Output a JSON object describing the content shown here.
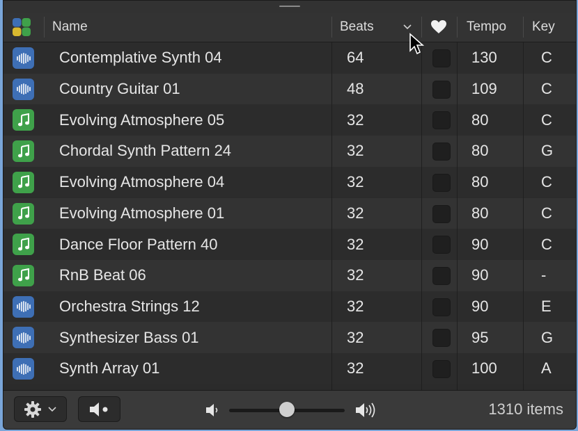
{
  "header": {
    "name": "Name",
    "beats": "Beats",
    "tempo": "Tempo",
    "key": "Key",
    "sort_icon": "chevron-down-icon",
    "favorite_icon": "heart-icon",
    "category_icon": "four-color-grid-icon"
  },
  "rows": [
    {
      "type": "audio",
      "name": "Contemplative Synth 04",
      "beats": "64",
      "tempo": "130",
      "key": "C"
    },
    {
      "type": "audio",
      "name": "Country Guitar 01",
      "beats": "48",
      "tempo": "109",
      "key": "C"
    },
    {
      "type": "midi",
      "name": "Evolving Atmosphere 05",
      "beats": "32",
      "tempo": "80",
      "key": "C"
    },
    {
      "type": "midi",
      "name": "Chordal Synth Pattern 24",
      "beats": "32",
      "tempo": "80",
      "key": "G"
    },
    {
      "type": "midi",
      "name": "Evolving Atmosphere 04",
      "beats": "32",
      "tempo": "80",
      "key": "C"
    },
    {
      "type": "midi",
      "name": "Evolving Atmosphere 01",
      "beats": "32",
      "tempo": "80",
      "key": "C"
    },
    {
      "type": "midi",
      "name": "Dance Floor Pattern 40",
      "beats": "32",
      "tempo": "90",
      "key": "C"
    },
    {
      "type": "midi",
      "name": "RnB Beat 06",
      "beats": "32",
      "tempo": "90",
      "key": "-"
    },
    {
      "type": "audio",
      "name": "Orchestra Strings 12",
      "beats": "32",
      "tempo": "90",
      "key": "E"
    },
    {
      "type": "audio",
      "name": "Synthesizer Bass 01",
      "beats": "32",
      "tempo": "95",
      "key": "G"
    },
    {
      "type": "audio",
      "name": "Synth Array 01",
      "beats": "32",
      "tempo": "100",
      "key": "A"
    }
  ],
  "footer": {
    "item_count": "1310 items",
    "volume_level": 0.5,
    "settings_icon": "gear-icon",
    "preview_icon": "speaker-dot-icon",
    "volume_low_icon": "speaker-low-icon",
    "volume_high_icon": "speaker-high-icon"
  },
  "colors": {
    "audio_icon_bg": "#3e6fb5",
    "midi_icon_bg": "#3fa14a"
  }
}
